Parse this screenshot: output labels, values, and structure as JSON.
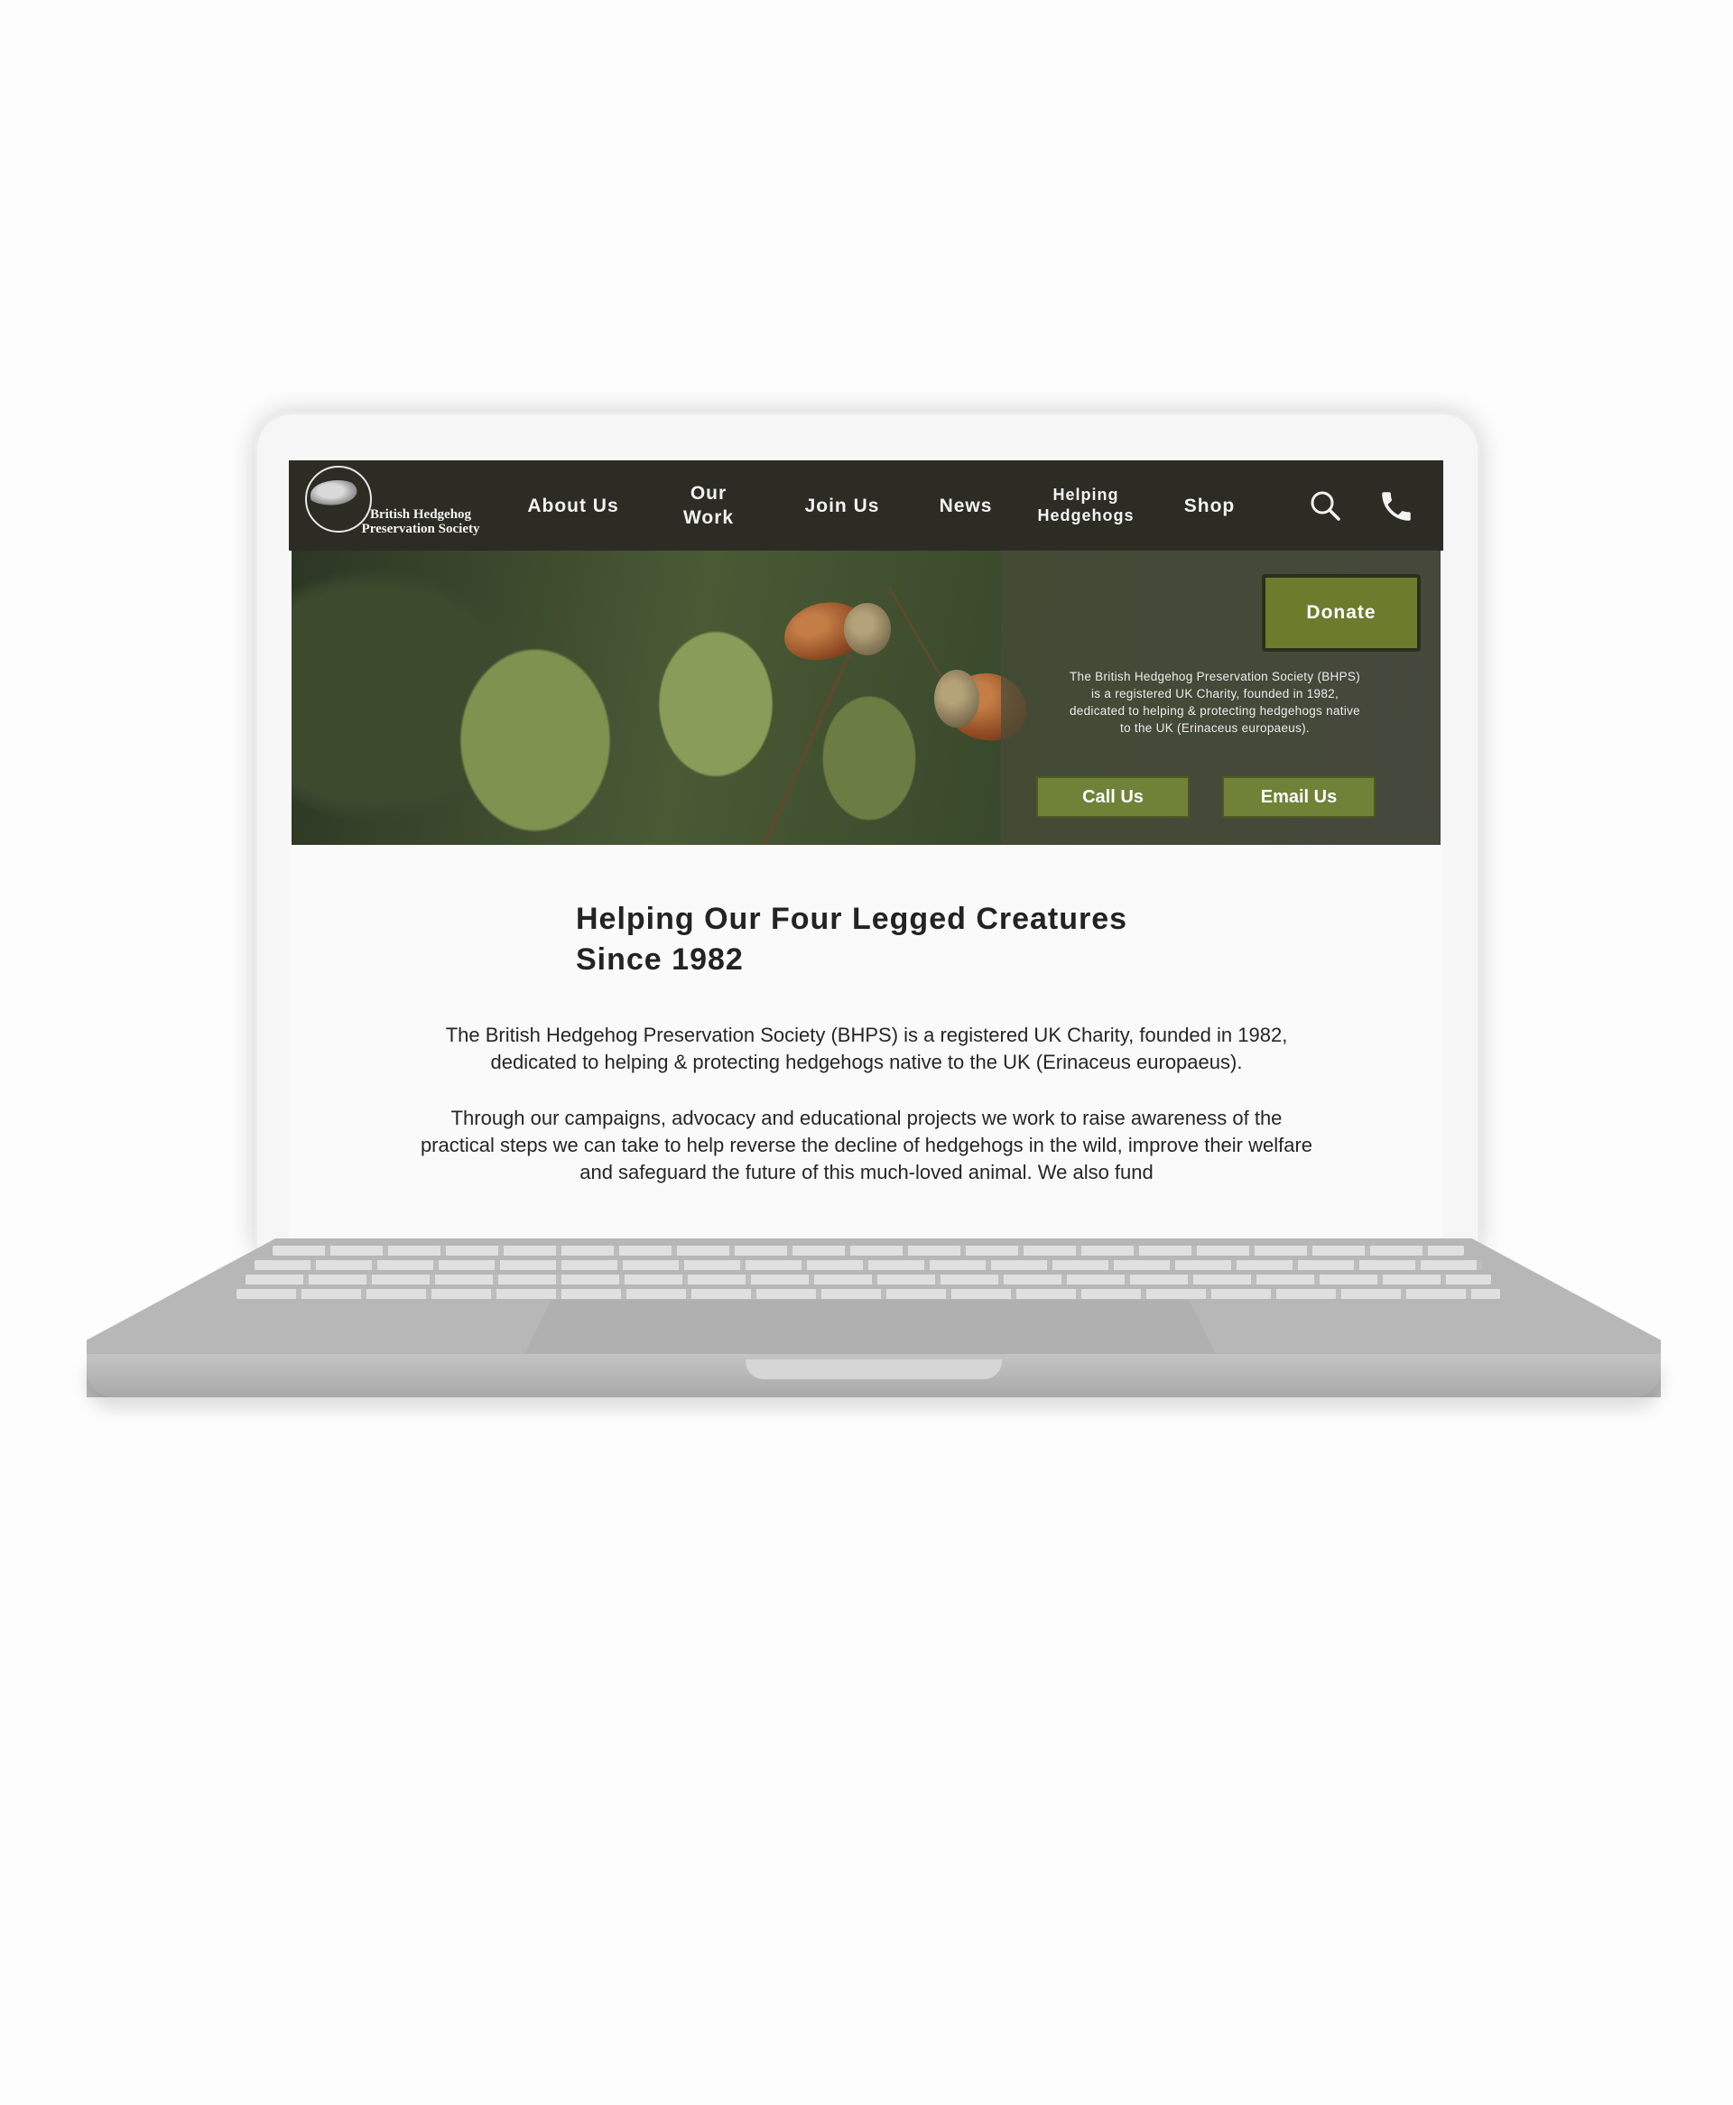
{
  "site": {
    "logo_text_line1": "British Hedgehog",
    "logo_text_line2": "Preservation Society"
  },
  "nav": {
    "items": [
      {
        "line1": "About Us",
        "line2": ""
      },
      {
        "line1": "Our",
        "line2": "Work"
      },
      {
        "line1": "Join Us",
        "line2": ""
      },
      {
        "line1": "News",
        "line2": ""
      },
      {
        "line1": "Helping",
        "line2": "Hedgehogs"
      },
      {
        "line1": "Shop",
        "line2": ""
      }
    ],
    "icons": [
      "search-icon",
      "phone-icon"
    ]
  },
  "hero": {
    "donate_label": "Donate",
    "intro": "The British Hedgehog Preservation Society (BHPS) is a registered UK Charity, founded in 1982, dedicated to helping & protecting hedgehogs native to the UK (Erinaceus europaeus).",
    "call_label": "Call Us",
    "email_label": "Email Us"
  },
  "main": {
    "headline_line1": "Helping Our Four Legged Creatures",
    "headline_line2": "Since 1982",
    "para1": "The British Hedgehog Preservation Society (BHPS) is a registered UK Charity, founded in 1982, dedicated to helping & protecting hedgehogs native to the UK (Erinaceus europaeus).",
    "para2": "Through our campaigns, advocacy and educational projects we work to raise awareness of the practical steps we can take to help reverse the decline of hedgehogs in the wild, improve their welfare and safeguard the future of this much-loved animal. We also fund"
  },
  "colors": {
    "nav_bg": "#2c2c25",
    "accent_green": "#6f8237",
    "donate_green": "#6d7b2c",
    "text_dark": "#232323"
  }
}
